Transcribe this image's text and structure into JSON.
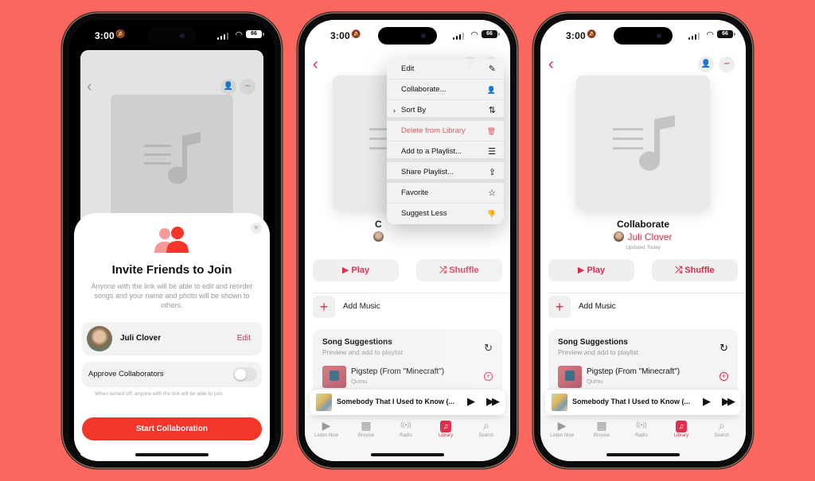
{
  "colors": {
    "background": "#f9675f",
    "accent": "#d82c4b",
    "start_button": "#f2362a"
  },
  "status_bar": {
    "time": "3:00",
    "silent_icon": "bell-slash-icon",
    "battery": "66"
  },
  "phone1": {
    "nav": {
      "back_icon": "‹",
      "collab_icon": "person-gear-icon",
      "more_icon": "···"
    },
    "sheet": {
      "close_icon": "✕",
      "icon": "people-icon",
      "title": "Invite Friends to Join",
      "description": "Anyone with the link will be able to edit and reorder songs and your name and photo will be shown to others.",
      "user": {
        "name": "Juli Clover",
        "edit_label": "Edit"
      },
      "approve": {
        "label": "Approve Collaborators",
        "enabled": false,
        "note": "When turned off, anyone with the link will be able to join."
      },
      "start_button": "Start Collaboration"
    }
  },
  "phone2": {
    "nav": {
      "back_icon": "‹",
      "more_icon": "···"
    },
    "playlist": {
      "title_partial": "C"
    },
    "menu": [
      {
        "label": "Edit",
        "icon": "✎",
        "icon_name": "pencil-icon"
      },
      {
        "label": "Collaborate...",
        "icon": "👤",
        "icon_name": "person-gear-icon"
      },
      {
        "label": "Sort By",
        "icon": "⇅",
        "icon_name": "sort-icon",
        "submenu": "›"
      },
      {
        "label": "Delete from Library",
        "icon": "🗑",
        "icon_name": "trash-icon",
        "destructive": true
      },
      {
        "label": "Add to a Playlist...",
        "icon": "☰",
        "icon_name": "add-to-playlist-icon"
      },
      {
        "label": "Share Playlist...",
        "icon": "⇪",
        "icon_name": "share-icon"
      },
      {
        "label": "Favorite",
        "icon": "☆",
        "icon_name": "star-icon"
      },
      {
        "label": "Suggest Less",
        "icon": "👎",
        "icon_name": "thumbs-down-icon"
      }
    ]
  },
  "playlist": {
    "title": "Collaborate",
    "owner": "Juli Clover",
    "updated": "Updated Today",
    "play_label": "▶ Play",
    "shuffle_label": "⤮ Shuffle",
    "add_music": "Add Music",
    "add_icon": "+"
  },
  "suggestions": {
    "title": "Song Suggestions",
    "subtitle": "Preview and add to playlist",
    "refresh_icon": "↻",
    "songs": [
      {
        "title": "Pigstep (From \"Minecraft\")",
        "artist": "Qumu",
        "add_icon": "+"
      }
    ]
  },
  "mini_player": {
    "title": "Somebody That I Used to Know (...",
    "play_icon": "▶",
    "forward_icon": "▶▶"
  },
  "tabs": [
    {
      "label": "Listen Now",
      "icon": "▶"
    },
    {
      "label": "Browse",
      "icon": "▦"
    },
    {
      "label": "Radio",
      "icon": "((•))"
    },
    {
      "label": "Library",
      "icon": "♫",
      "active": true
    },
    {
      "label": "Search",
      "icon": "⌕"
    }
  ]
}
